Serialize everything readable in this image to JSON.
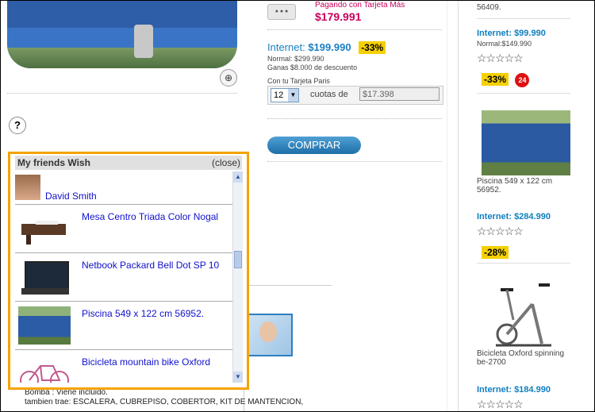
{
  "product": {
    "pay_card_label": "Pagando con Tarjeta Más",
    "pay_card_price": "$179.991",
    "internet_label": "Internet:",
    "internet_price": "$199.990",
    "discount_badge": "-33%",
    "normal_price": "Normal: $299.990",
    "savings": "Ganas $8.000 de descuento",
    "card_label": "Con tu Tarjeta Paris",
    "installments_selected": "12",
    "cuotas_label": "cuotas de",
    "cuota_value": "$17.398",
    "buy_button": "COMPRAR",
    "help": "?"
  },
  "wish_popup": {
    "title": "My friends Wish",
    "close_label": "(close)",
    "user_name": "David Smith",
    "items": [
      {
        "name": "Mesa Centro Triada Color Nogal",
        "thumb": "coffee-table"
      },
      {
        "name": "Netbook Packard Bell Dot SP 10",
        "thumb": "netbook"
      },
      {
        "name": "Piscina 549 x 122 cm 56952.",
        "thumb": "pool"
      },
      {
        "name": "Bicicleta mountain bike Oxford",
        "thumb": "bicycle"
      }
    ]
  },
  "description": {
    "line1": "Bomba : Viene incluido.",
    "line2": "tambien trae: ESCALERA, CUBREPISO, COBERTOR, KIT DE MANTENCION,"
  },
  "sidebar": {
    "top_code": "56409.",
    "items": [
      {
        "internet_label": "Internet:",
        "price": "$99.990",
        "normal": "Normal:$149.990",
        "stars": "☆☆☆☆☆",
        "badge": "-33%",
        "extra_badge": "24"
      },
      {
        "caption": "Piscina 549 x 122 cm 56952.",
        "internet_label": "Internet:",
        "price": "$284.990",
        "stars": "☆☆☆☆☆",
        "badge": "-28%"
      },
      {
        "caption": "Bicicleta Oxford spinning be-2700",
        "internet_label": "Internet:",
        "price": "$184.990",
        "stars": "☆☆☆☆☆"
      }
    ]
  }
}
